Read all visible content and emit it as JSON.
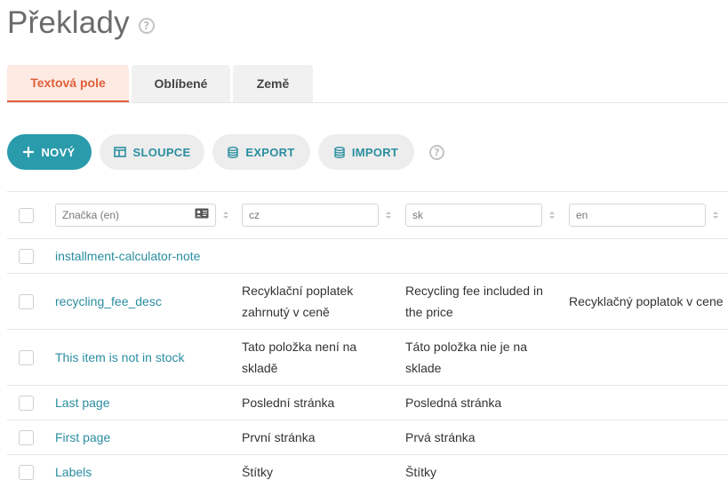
{
  "page": {
    "title": "Překlady"
  },
  "tabs": [
    {
      "label": "Textová pole",
      "active": true
    },
    {
      "label": "Oblíbené",
      "active": false
    },
    {
      "label": "Země",
      "active": false
    }
  ],
  "toolbar": {
    "new_label": "NOVÝ",
    "columns_label": "SLOUPCE",
    "export_label": "EXPORT",
    "import_label": "IMPORT"
  },
  "filters": {
    "key_placeholder": "Značka (en)",
    "cz": "cz",
    "sk": "sk",
    "en": "en"
  },
  "rows": [
    {
      "key": "installment-calculator-note",
      "cz": "",
      "sk": "",
      "en": ""
    },
    {
      "key": "recycling_fee_desc",
      "cz": "Recyklační poplatek zahrnutý v ceně",
      "sk": "Recycling fee included in the price",
      "en": "Recyklačný poplatok v cene"
    },
    {
      "key": "This item is not in stock",
      "cz": "Tato položka není na skladě",
      "sk": "Táto položka nie je na sklade",
      "en": ""
    },
    {
      "key": "Last page",
      "cz": "Poslední stránka",
      "sk": "Posledná stránka",
      "en": ""
    },
    {
      "key": "First page",
      "cz": "První stránka",
      "sk": "Prvá stránka",
      "en": ""
    },
    {
      "key": "Labels",
      "cz": "Štítky",
      "sk": "Štítky",
      "en": ""
    }
  ],
  "colors": {
    "accent": "#2a9bab",
    "tab_active": "#e0603a",
    "link": "#2a8ea0"
  },
  "icons": [
    "help-icon",
    "plus-icon",
    "columns-icon",
    "database-icon",
    "contact-card-icon",
    "sort-icon"
  ]
}
